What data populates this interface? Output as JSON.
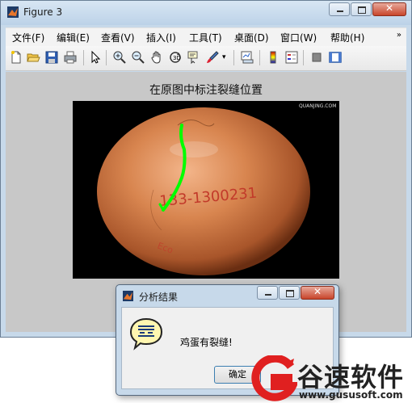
{
  "window": {
    "title": "Figure 3",
    "menu": [
      "文件(F)",
      "编辑(E)",
      "查看(V)",
      "插入(I)",
      "工具(T)",
      "桌面(D)",
      "窗口(W)",
      "帮助(H)"
    ],
    "menu_overflow": "»",
    "toolbar_icons": [
      "new-figure-icon",
      "open-file-icon",
      "save-icon",
      "print-icon",
      "pointer-icon",
      "zoom-in-icon",
      "zoom-out-icon",
      "pan-icon",
      "rotate-3d-icon",
      "data-cursor-icon",
      "brush-icon",
      "link-plot-icon",
      "colorbar-icon",
      "legend-icon",
      "hide-plot-tools-icon",
      "show-plot-tools-icon"
    ]
  },
  "figure": {
    "title": "在原图中标注裂缝位置",
    "image": {
      "stamp_text": "133-1300231",
      "corner_text": "QUANJING.COM",
      "crack_color": "#00ff00"
    }
  },
  "dialog": {
    "title": "分析结果",
    "message": "鸡蛋有裂缝!",
    "ok_label": "确定"
  },
  "watermark": {
    "name": "谷速软件",
    "url": "www.gususoft.com"
  }
}
